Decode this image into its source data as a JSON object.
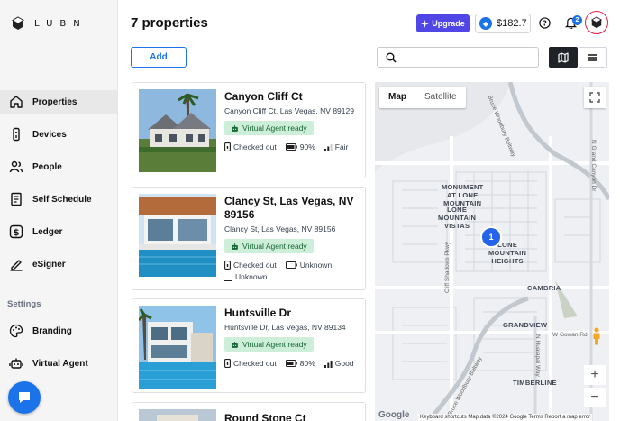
{
  "brand": {
    "name": "LUBN"
  },
  "sidebar": {
    "items": [
      {
        "label": "Properties",
        "icon": "home-icon",
        "active": true
      },
      {
        "label": "Devices",
        "icon": "lock-device-icon"
      },
      {
        "label": "People",
        "icon": "people-icon"
      },
      {
        "label": "Self Schedule",
        "icon": "calendar-icon"
      },
      {
        "label": "Ledger",
        "icon": "dollar-icon"
      },
      {
        "label": "eSigner",
        "icon": "pen-icon"
      }
    ],
    "settings_heading": "Settings",
    "settings_items": [
      {
        "label": "Branding",
        "icon": "palette-icon"
      },
      {
        "label": "Virtual Agent",
        "icon": "robot-icon"
      }
    ]
  },
  "header": {
    "title": "7 properties",
    "upgrade_label": "Upgrade",
    "balance": "$182.7",
    "notification_count": "2"
  },
  "toolbar": {
    "add_label": "Add",
    "search_placeholder": "",
    "active_view": "map"
  },
  "properties": [
    {
      "title": "Canyon Cliff Ct",
      "address": "Canyon Cliff Ct, Las Vegas, NV 89129",
      "agent": "Virtual Agent ready",
      "lock_status": "Checked out",
      "battery": "90%",
      "signal": "Fair"
    },
    {
      "title": "Clancy St, Las Vegas, NV 89156",
      "address": "Clancy St, Las Vegas, NV 89156",
      "agent": "Virtual Agent ready",
      "lock_status": "Checked out",
      "battery": "Unknown",
      "signal": "Unknown"
    },
    {
      "title": "Huntsville Dr",
      "address": "Huntsville Dr, Las Vegas, NV 89134",
      "agent": "Virtual Agent ready",
      "lock_status": "Checked out",
      "battery": "80%",
      "signal": "Good"
    },
    {
      "title": "Round Stone Ct"
    }
  ],
  "map": {
    "tab_map": "Map",
    "tab_satellite": "Satellite",
    "active_tab": "Map",
    "cluster_count": "1",
    "labels": {
      "monument": "MONUMENT\nAT LONE\nMOUNTAIN",
      "lone_vistas": "LONE\nMOUNTAIN\nVISTAS",
      "lone_heights": "LONE\nMOUNTAIN\nHEIGHTS",
      "cambria": "CAMBRIA",
      "grandview": "GRANDVIEW",
      "timberline": "TIMBERLINE"
    },
    "streets": {
      "beltway_top": "Bruce Woodbury Beltway",
      "grand_canyon": "N Grand Canyon Dr",
      "cliff_shadows": "Cliff Shadows Pkwy",
      "gowan": "W Gowan Rd",
      "hualapai": "N Hualapai Way",
      "beltway_bottom": "Bruce Woodbury Beltway"
    },
    "google": "Google",
    "attribution": "Keyboard shortcuts   Map data ©2024 Google   Terms   Report a map error"
  },
  "colors": {
    "accent": "#1a73e8",
    "upgrade": "#4f46e5",
    "agent_pill": "#cdeed8",
    "avatar_ring": "#e11d48"
  }
}
